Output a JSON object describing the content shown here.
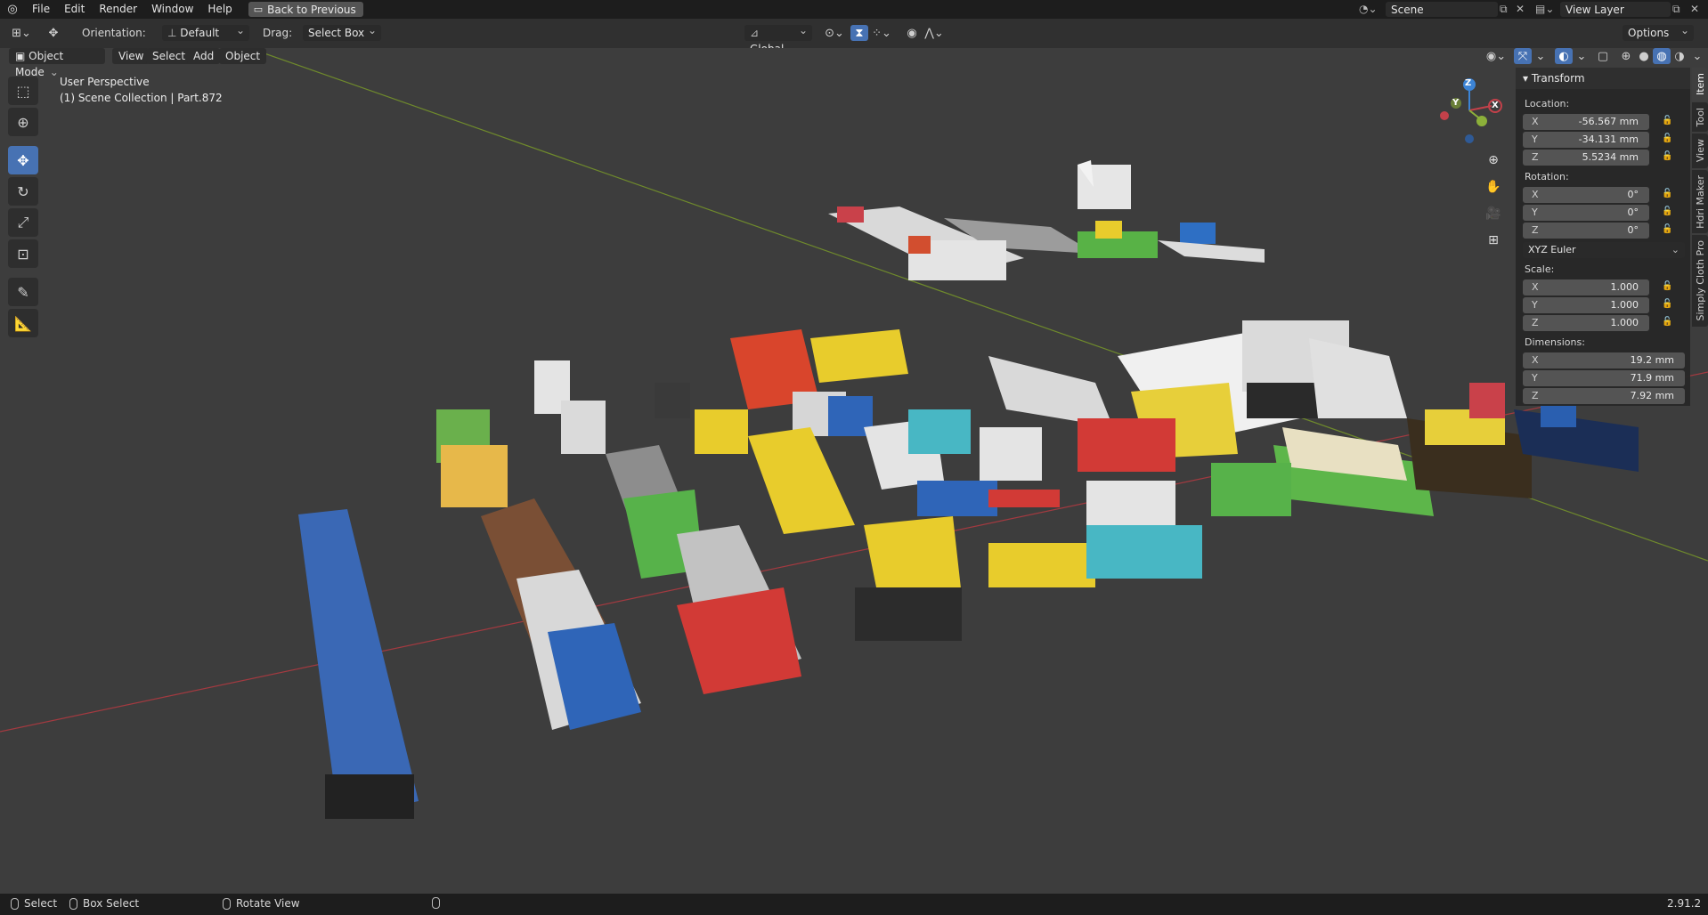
{
  "menu": {
    "items": [
      "File",
      "Edit",
      "Render",
      "Window",
      "Help"
    ],
    "back_button": "Back to Previous"
  },
  "scene": {
    "name": "Scene",
    "view_layer": "View Layer"
  },
  "tool_header": {
    "orientation_label": "Orientation:",
    "orientation_value": "Default",
    "drag_label": "Drag:",
    "drag_value": "Select Box",
    "transform_orientation": "Global",
    "options_label": "Options"
  },
  "viewport_header": {
    "mode": "Object Mode",
    "menus": [
      "View",
      "Select",
      "Add",
      "Object"
    ]
  },
  "viewport": {
    "perspective": "User Perspective",
    "collection": "(1) Scene Collection | Part.872",
    "axis_x": "X",
    "axis_y": "Y",
    "axis_z": "Z"
  },
  "transform_panel": {
    "title": "Transform",
    "location_label": "Location:",
    "location": [
      {
        "axis": "X",
        "value": "-56.567 mm"
      },
      {
        "axis": "Y",
        "value": "-34.131 mm"
      },
      {
        "axis": "Z",
        "value": "5.5234 mm"
      }
    ],
    "rotation_label": "Rotation:",
    "rotation": [
      {
        "axis": "X",
        "value": "0°"
      },
      {
        "axis": "Y",
        "value": "0°"
      },
      {
        "axis": "Z",
        "value": "0°"
      }
    ],
    "rotation_mode": "XYZ Euler",
    "scale_label": "Scale:",
    "scale": [
      {
        "axis": "X",
        "value": "1.000"
      },
      {
        "axis": "Y",
        "value": "1.000"
      },
      {
        "axis": "Z",
        "value": "1.000"
      }
    ],
    "dimensions_label": "Dimensions:",
    "dimensions": [
      {
        "axis": "X",
        "value": "19.2 mm"
      },
      {
        "axis": "Y",
        "value": "71.9 mm"
      },
      {
        "axis": "Z",
        "value": "7.92 mm"
      }
    ]
  },
  "sidebar_tabs": [
    "Item",
    "Tool",
    "View",
    "Hdri Maker",
    "Simply Cloth Pro"
  ],
  "status_bar": {
    "select": "Select",
    "box_select": "Box Select",
    "rotate_view": "Rotate View",
    "version": "2.91.2"
  },
  "colors": {
    "accent": "#4772b3",
    "x_axis": "#c3414a",
    "y_axis": "#8cb03a",
    "z_axis": "#3c84d6"
  }
}
